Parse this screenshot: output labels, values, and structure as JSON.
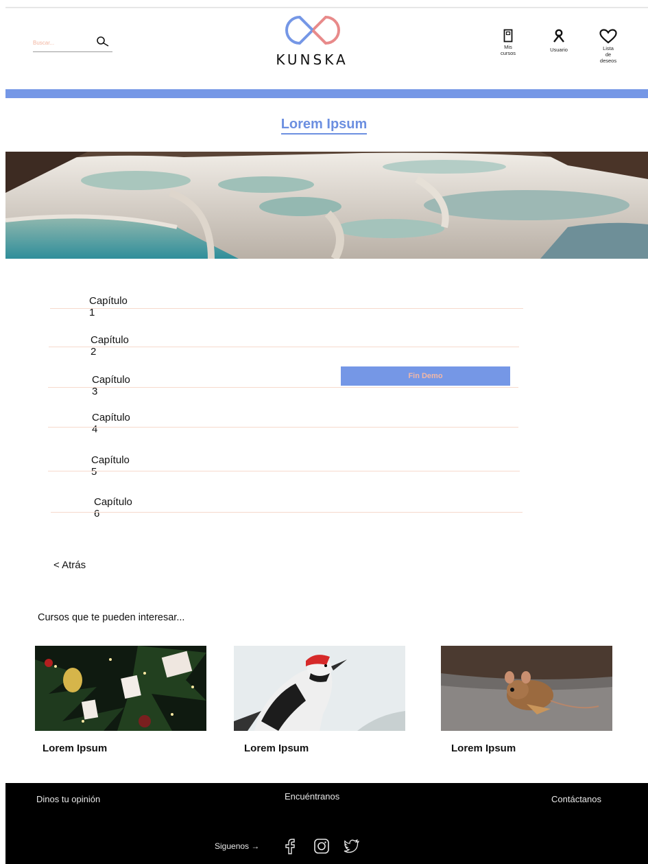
{
  "header": {
    "search_placeholder": "Buscar...",
    "brand": "KUNSKA",
    "nav": {
      "mis_cursos": "Mis\ncursos",
      "usuario": "Usuario",
      "lista_deseos": "Lista\nde\ndeseos"
    }
  },
  "colors": {
    "accent_blue": "#7597e6",
    "accent_salmon": "#f2b7a6",
    "logo_red": "#e88a8a"
  },
  "page": {
    "title": "Lorem Ipsum"
  },
  "chapters": [
    "Capítulo 1",
    "Capítulo 2",
    "Capítulo 3",
    "Capítulo 4",
    "Capítulo 5",
    "Capítulo 6"
  ],
  "demo_button": "Fin Demo",
  "back_link": "< Atrás",
  "recommendations": {
    "heading": "Cursos que te pueden interesar...",
    "courses": [
      {
        "title": "Lorem Ipsum",
        "image": "christmas-tree-ornaments"
      },
      {
        "title": "Lorem Ipsum",
        "image": "woodpecker"
      },
      {
        "title": "Lorem Ipsum",
        "image": "mouse"
      }
    ]
  },
  "footer": {
    "opinion": "Dinos tu opinión",
    "find_us": "Encuéntranos",
    "contact": "Contáctanos",
    "follow": "Siguenos",
    "social": [
      "facebook-icon",
      "instagram-icon",
      "twitter-icon"
    ]
  }
}
